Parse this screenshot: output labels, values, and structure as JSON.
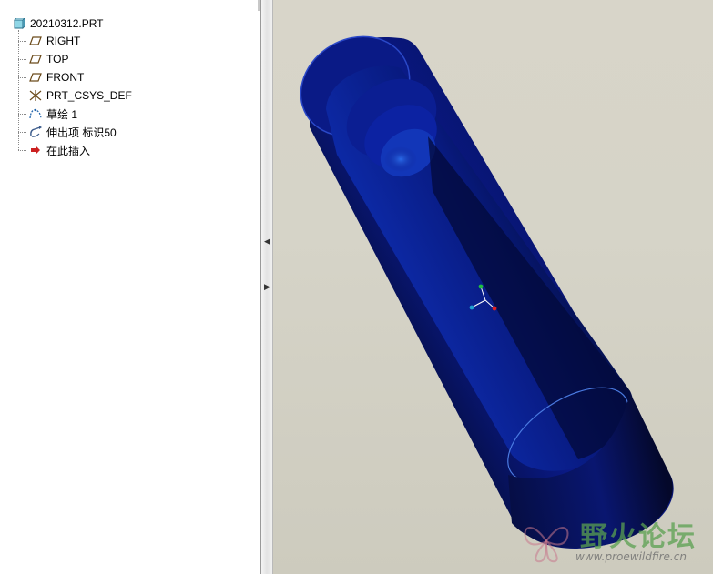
{
  "model_tree": {
    "root": {
      "label": "20210312.PRT",
      "icon": "part-icon"
    },
    "items": [
      {
        "label": "RIGHT",
        "icon": "datum-plane-icon"
      },
      {
        "label": "TOP",
        "icon": "datum-plane-icon"
      },
      {
        "label": "FRONT",
        "icon": "datum-plane-icon"
      },
      {
        "label": "PRT_CSYS_DEF",
        "icon": "coordinate-system-icon"
      },
      {
        "label": "草绘 1",
        "icon": "sketch-icon"
      },
      {
        "label": "伸出项 标识50",
        "icon": "extrude-icon"
      },
      {
        "label": "在此插入",
        "icon": "insert-here-arrow-icon"
      }
    ]
  },
  "splitter": {
    "collapse_icon": "chevron-left-icon",
    "expand_icon": "chevron-right-icon"
  },
  "viewport": {
    "model_color": "#0a1a8a",
    "background_color": "#d6d4c8",
    "csys_colors": {
      "x": "#e02020",
      "y": "#20c040",
      "z": "#20a0d0"
    }
  },
  "watermark": {
    "title": "野火论坛",
    "url": "www.proewildfire.cn"
  }
}
